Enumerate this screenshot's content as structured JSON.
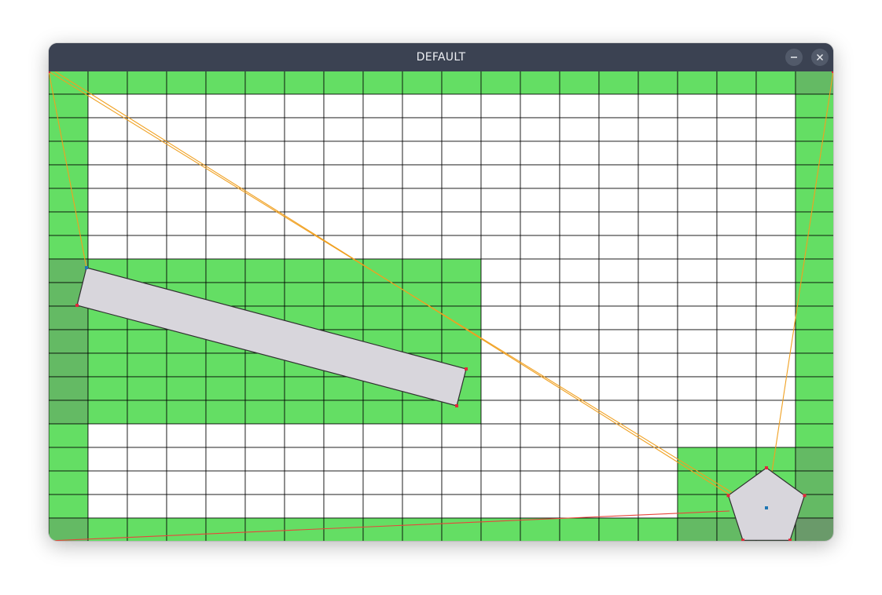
{
  "window": {
    "title": "DEFAULT",
    "minimize_icon": "minimize-icon",
    "close_icon": "close-icon"
  },
  "scene": {
    "colors": {
      "cell_empty": "#ffffff",
      "cell_wall": "#64de64",
      "cell_wall_shaded": "#64ba64",
      "cell_wall_dark": "#6a9a6a",
      "grid_line": "#000000",
      "obstacle_fill": "#d8d6dc",
      "obstacle_stroke": "#303030",
      "vertex_red": "#e0283a",
      "vertex_blue": "#1f77b4",
      "ray_orange": "#f0a020",
      "ray_red": "#e8453c"
    },
    "shapes": {
      "rectangle": "rotated-rectangle",
      "pentagon": "pentagon"
    }
  }
}
